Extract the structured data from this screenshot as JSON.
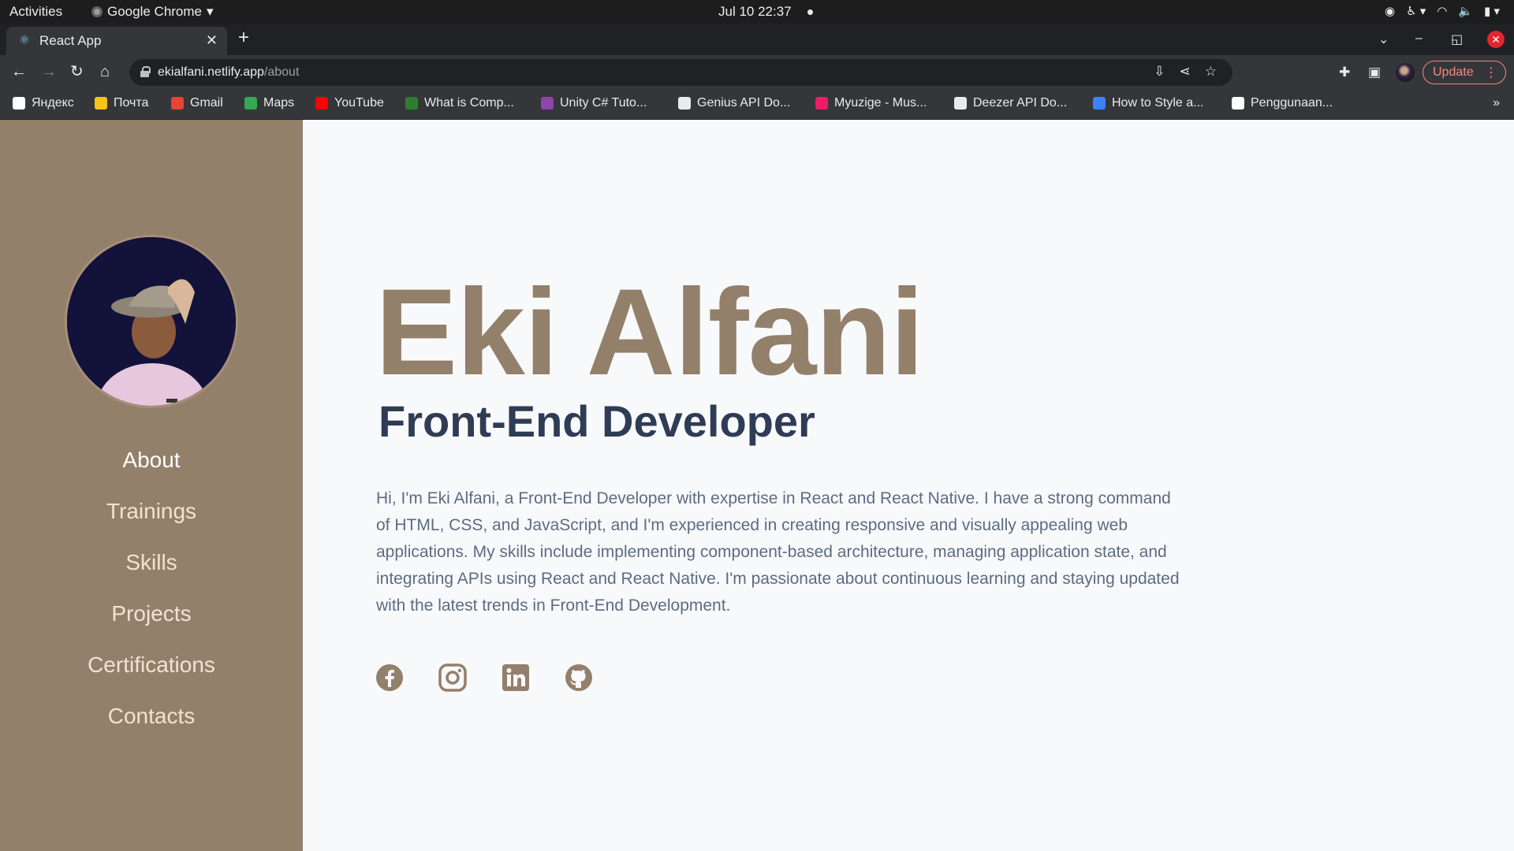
{
  "system": {
    "activities": "Activities",
    "app_menu": "Google Chrome",
    "clock": "Jul 10  22:37"
  },
  "browser": {
    "tab_title": "React App",
    "url_host": "ekialfani.netlify.app",
    "url_path": "/about",
    "update_label": "Update",
    "bookmarks": [
      {
        "label": "Яндекс",
        "icon": "yandex-icon",
        "color": "#ffffff"
      },
      {
        "label": "Почта",
        "icon": "mail-icon",
        "color": "#f5c518"
      },
      {
        "label": "Gmail",
        "icon": "gmail-icon",
        "color": "#ea4335"
      },
      {
        "label": "Maps",
        "icon": "maps-icon",
        "color": "#34a853"
      },
      {
        "label": "YouTube",
        "icon": "youtube-icon",
        "color": "#ff0000"
      },
      {
        "label": "What is Comp...",
        "icon": "link-icon",
        "color": "#2e7d32"
      },
      {
        "label": "Unity C# Tuto...",
        "icon": "c-icon",
        "color": "#8e44ad"
      },
      {
        "label": "Genius API Do...",
        "icon": "octocat-icon",
        "color": "#e8eaed"
      },
      {
        "label": "Myuzige - Mus...",
        "icon": "music-icon",
        "color": "#e91e63"
      },
      {
        "label": "Deezer API Do...",
        "icon": "octocat-icon",
        "color": "#e8eaed"
      },
      {
        "label": "How to Style a...",
        "icon": "vite-icon",
        "color": "#3b82f6"
      },
      {
        "label": "Penggunaan...",
        "icon": "medium-icon",
        "color": "#ffffff"
      }
    ]
  },
  "sidebar": {
    "nav": [
      {
        "label": "About",
        "active": true
      },
      {
        "label": "Trainings",
        "active": false
      },
      {
        "label": "Skills",
        "active": false
      },
      {
        "label": "Projects",
        "active": false
      },
      {
        "label": "Certifications",
        "active": false
      },
      {
        "label": "Contacts",
        "active": false
      }
    ]
  },
  "main": {
    "name": "Eki Alfani",
    "role": "Front-End Developer",
    "bio": "Hi, I'm Eki Alfani, a Front-End Developer with expertise in React and React Native. I have a strong command of HTML, CSS, and JavaScript, and I'm experienced in creating responsive and visually appealing web applications. My skills include implementing component-based architecture, managing application state, and integrating APIs using React and React Native. I'm passionate about continuous learning and staying updated with the latest trends in Front-End Development.",
    "socials": [
      "facebook-icon",
      "instagram-icon",
      "linkedin-icon",
      "github-icon"
    ]
  },
  "colors": {
    "brand": "#93806a",
    "heading": "#2f3c55",
    "body_text": "#5d6c82",
    "nav_text": "#f1e4cf"
  }
}
